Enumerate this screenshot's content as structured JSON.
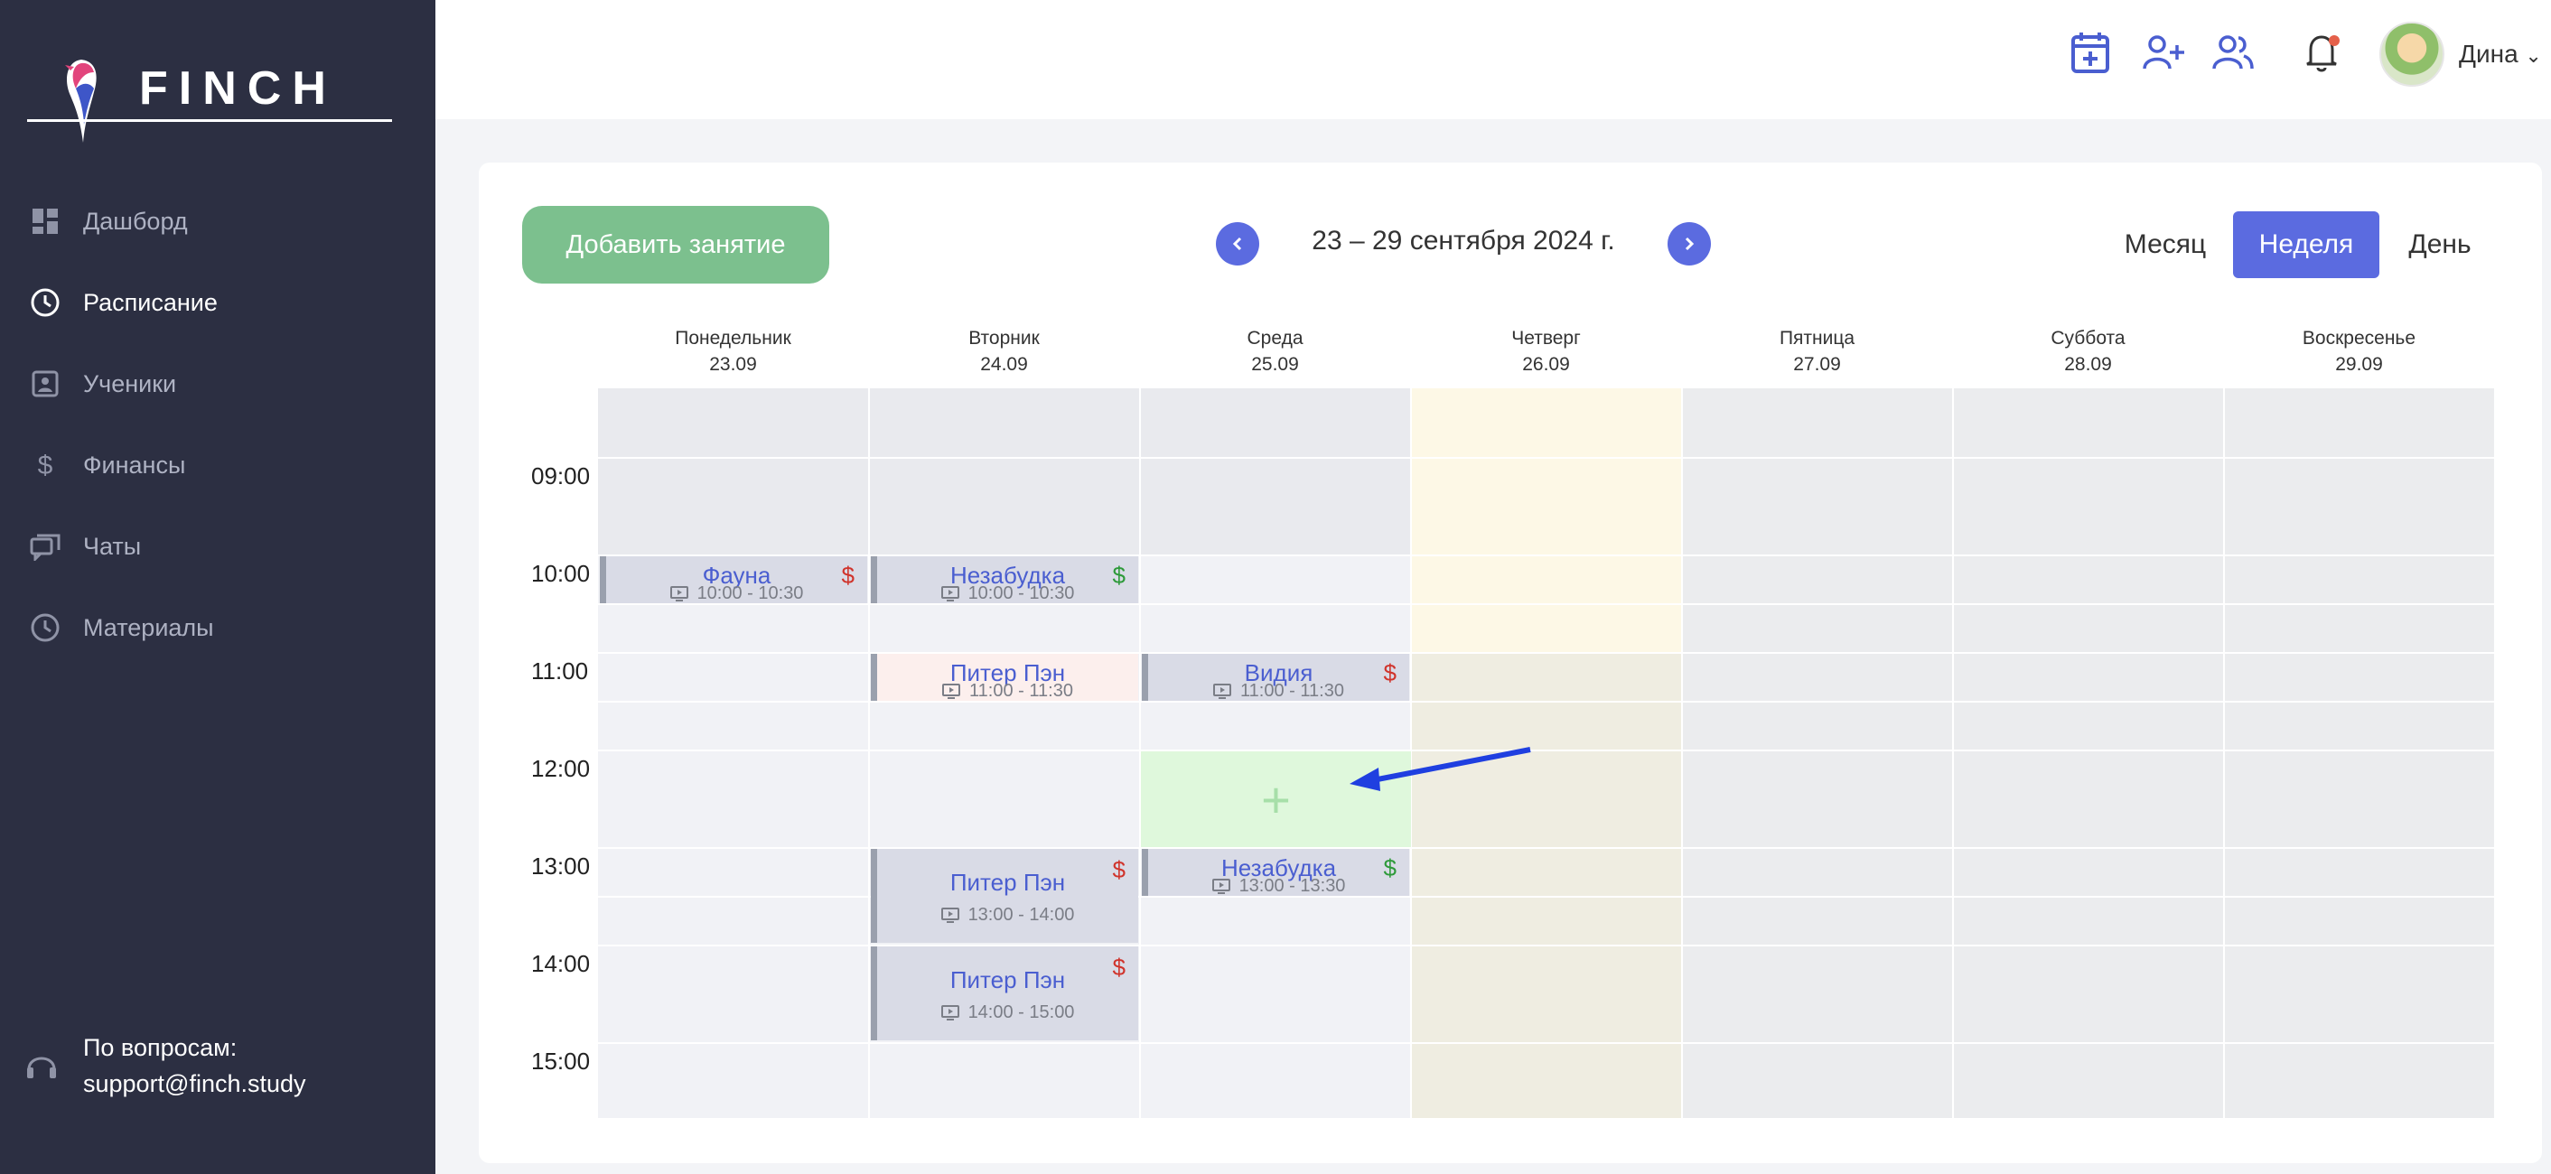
{
  "brand": {
    "name": "FINCH"
  },
  "sidebar": {
    "items": [
      {
        "label": "Дашборд",
        "icon": "dashboard-icon",
        "active": false
      },
      {
        "label": "Расписание",
        "icon": "clock-icon",
        "active": true
      },
      {
        "label": "Ученики",
        "icon": "student-card-icon",
        "active": false
      },
      {
        "label": "Финансы",
        "icon": "dollar-icon",
        "active": false
      },
      {
        "label": "Чаты",
        "icon": "chat-icon",
        "active": false
      },
      {
        "label": "Материалы",
        "icon": "clock-icon",
        "active": false
      }
    ],
    "support": {
      "line1": "По вопросам:",
      "line2": "support@finch.study"
    }
  },
  "header": {
    "icons": [
      "calendar-add-icon",
      "add-user-icon",
      "users-icon",
      "bell-icon"
    ],
    "notification_dot": true,
    "user": {
      "name": "Дина",
      "caret": "⌄"
    }
  },
  "toolbar": {
    "add_lesson": "Добавить занятие",
    "date_range": "23 – 29 сентября 2024 г.",
    "views": [
      {
        "label": "Месяц",
        "active": false
      },
      {
        "label": "Неделя",
        "active": true
      },
      {
        "label": "День",
        "active": false
      }
    ]
  },
  "calendar": {
    "days": [
      {
        "name": "Понедельник",
        "date": "23.09"
      },
      {
        "name": "Вторник",
        "date": "24.09"
      },
      {
        "name": "Среда",
        "date": "25.09"
      },
      {
        "name": "Четверг",
        "date": "26.09"
      },
      {
        "name": "Пятница",
        "date": "27.09"
      },
      {
        "name": "Суббота",
        "date": "28.09"
      },
      {
        "name": "Воскресенье",
        "date": "29.09"
      }
    ],
    "times": [
      "09:00",
      "10:00",
      "11:00",
      "12:00",
      "13:00",
      "14:00",
      "15:00"
    ],
    "events": [
      {
        "name": "Фауна",
        "time": "10:00 - 10:30",
        "currency": "$",
        "paid": false
      },
      {
        "name": "Незабудка",
        "time": "10:00 - 10:30",
        "currency": "$",
        "paid": true
      },
      {
        "name": "Питер Пэн",
        "time": "11:00 - 11:30",
        "currency": "",
        "paid": false
      },
      {
        "name": "Видия",
        "time": "11:00 - 11:30",
        "currency": "$",
        "paid": false
      },
      {
        "name": "Питер Пэн",
        "time": "13:00 - 14:00",
        "currency": "$",
        "paid": false
      },
      {
        "name": "Незабудка",
        "time": "13:00 - 13:30",
        "currency": "$",
        "paid": true
      },
      {
        "name": "Питер Пэн",
        "time": "14:00 - 15:00",
        "currency": "$",
        "paid": false
      }
    ],
    "add_slot_symbol": "+"
  },
  "colors": {
    "sidebar_bg": "#2c2f42",
    "accent": "#5b6be0",
    "add_button": "#7cc08e",
    "paid": "#2e9a3a",
    "unpaid": "#d0342c",
    "annotation_arrow": "#1f3fe0"
  }
}
